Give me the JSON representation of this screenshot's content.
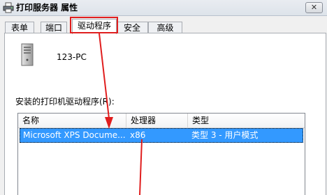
{
  "window": {
    "title": "打印服务器 属性",
    "close_glyph": "✕"
  },
  "tabs": [
    {
      "label": "表单"
    },
    {
      "label": "端口"
    },
    {
      "label": "驱动程序"
    },
    {
      "label": "安全"
    },
    {
      "label": "高级"
    }
  ],
  "active_tab": "驱动程序",
  "server": {
    "name": "123-PC",
    "icon": "server-icon"
  },
  "drivers": {
    "label": "安装的打印机驱动程序(R):",
    "columns": [
      "名称",
      "处理器",
      "类型"
    ],
    "rows": [
      {
        "name": "Microsoft XPS Docume...",
        "processor": "x86",
        "type": "类型 3 - 用户模式",
        "selected": true
      }
    ]
  },
  "colors": {
    "annotation": "#e01e1e",
    "selection": "#3399ff"
  }
}
